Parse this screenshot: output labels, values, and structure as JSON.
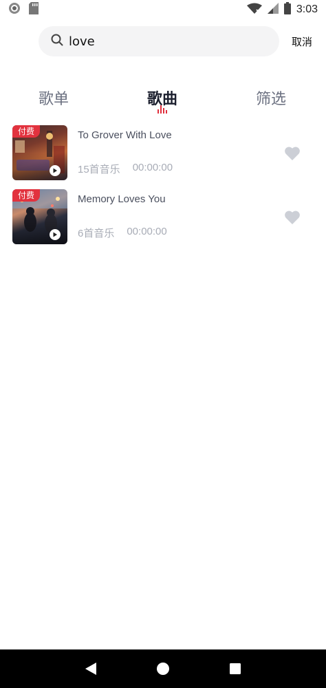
{
  "status_bar": {
    "time": "3:03",
    "left_icons": [
      "record-icon",
      "sd-card-icon"
    ],
    "right_icons": [
      "wifi-icon",
      "cellular-icon",
      "battery-icon"
    ]
  },
  "search": {
    "value": "love",
    "placeholder": "",
    "cancel_label": "取消"
  },
  "tabs": [
    {
      "label": "歌单",
      "active": false
    },
    {
      "label": "歌曲",
      "active": true
    },
    {
      "label": "筛选",
      "active": false
    }
  ],
  "songs": [
    {
      "badge": "付费",
      "title": "To Grover With Love",
      "count": "15首音乐",
      "duration": "00:00:00",
      "favorited": false
    },
    {
      "badge": "付费",
      "title": "Memory Loves You",
      "count": "6首音乐",
      "duration": "00:00:00",
      "favorited": false
    }
  ],
  "colors": {
    "accent": "#e2323e",
    "tab_active": "#1b1f2e",
    "tab_inactive": "#6b7080",
    "meta_text": "#a8acb6",
    "heart": "#cccfd6"
  },
  "nav_bar": {
    "icons": [
      "back-icon",
      "home-icon",
      "recents-icon"
    ]
  }
}
